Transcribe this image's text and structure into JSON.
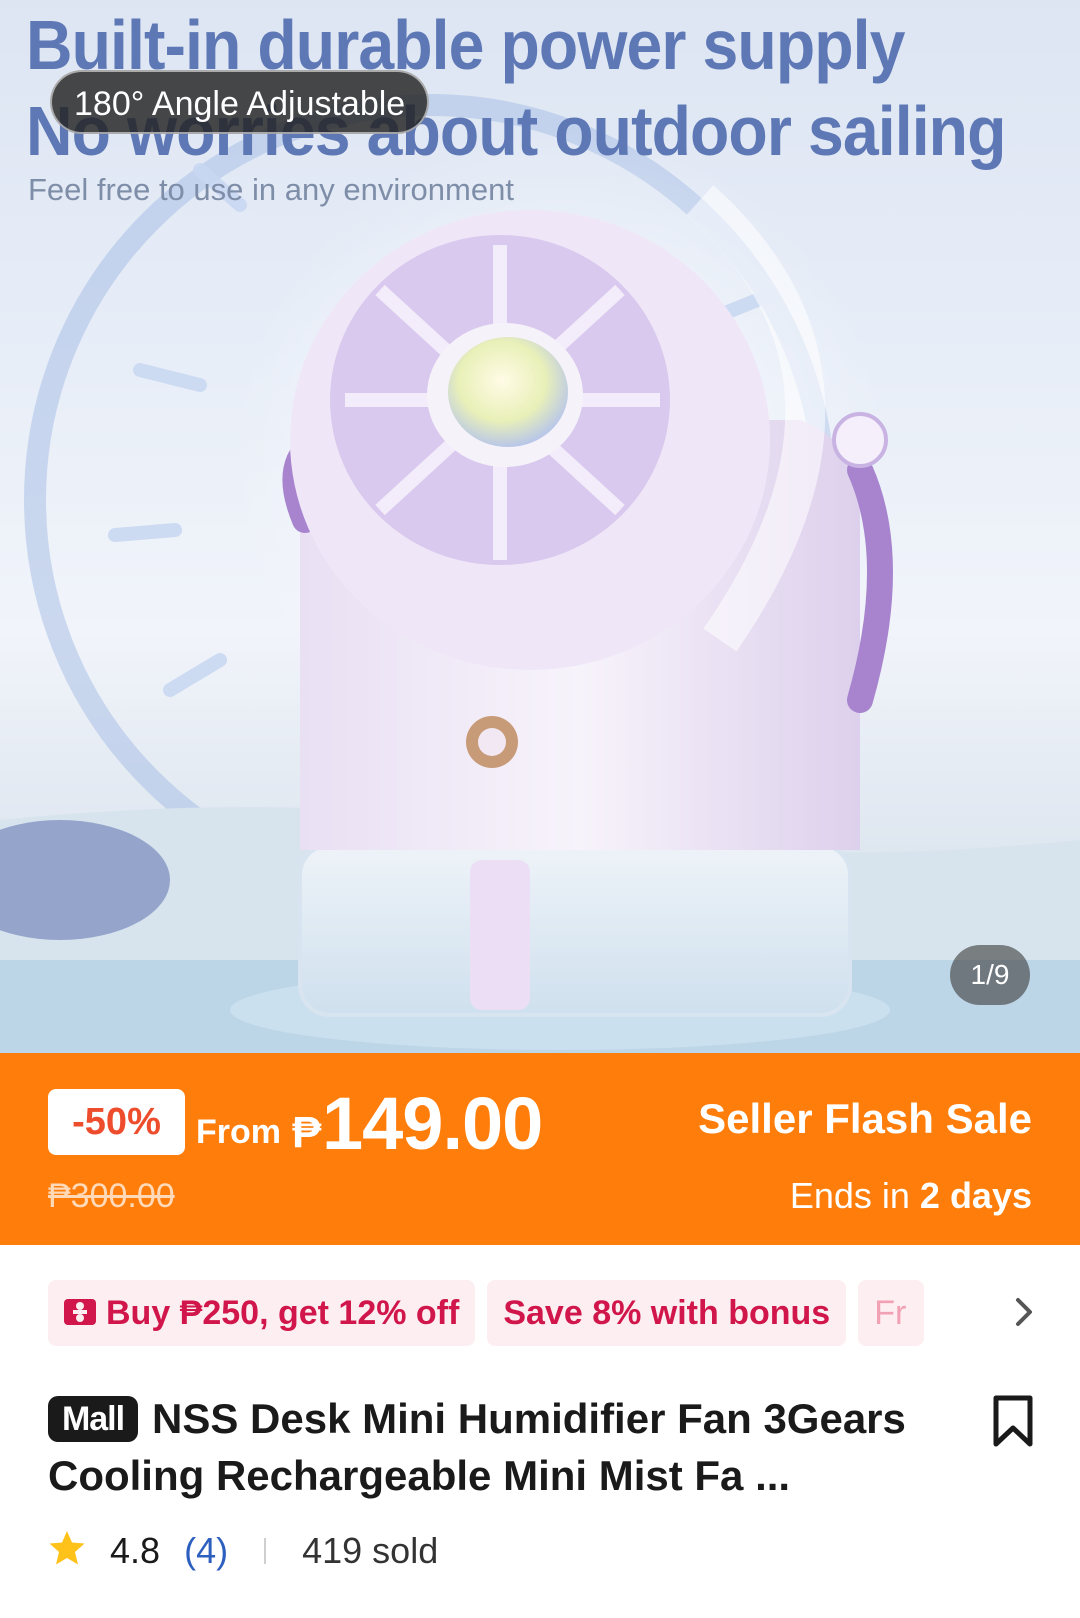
{
  "hero": {
    "headline_line1": "Built-in durable power supply",
    "headline_line2": "No worries about outdoor sailing",
    "subtitle": "Feel free to use in any environment",
    "angle_badge": "180° Angle Adjustable",
    "image_counter": "1/9"
  },
  "flash_sale": {
    "discount": "-50%",
    "from_label": "From",
    "currency": "₱",
    "price": "149.00",
    "original_price": "₱300.00",
    "title": "Seller Flash Sale",
    "ends_prefix": "Ends in",
    "ends_value": "2 days"
  },
  "promos": {
    "chips": [
      {
        "label": "Buy ₱250, get 12% off",
        "icon": "voucher-icon"
      },
      {
        "label": "Save 8% with bonus"
      },
      {
        "label": "Fr"
      }
    ],
    "more_icon": "chevron-right-icon"
  },
  "product": {
    "mall_badge": "Mall",
    "title": "NSS Desk Mini Humidifier Fan 3Gears Cooling Rechargeable Mini Mist Fa ...",
    "bookmark_icon": "bookmark-icon"
  },
  "rating": {
    "star_icon": "star-icon",
    "value": "4.8",
    "count": "(4)",
    "sold": "419 sold"
  },
  "colors": {
    "sale_orange": "#ff7d0a",
    "discount_red": "#ee4d2d",
    "promo_pink": "#d0164a",
    "promo_bg": "#fdeef1",
    "link_blue": "#2d5fbf",
    "star_yellow": "#ffc21a"
  }
}
